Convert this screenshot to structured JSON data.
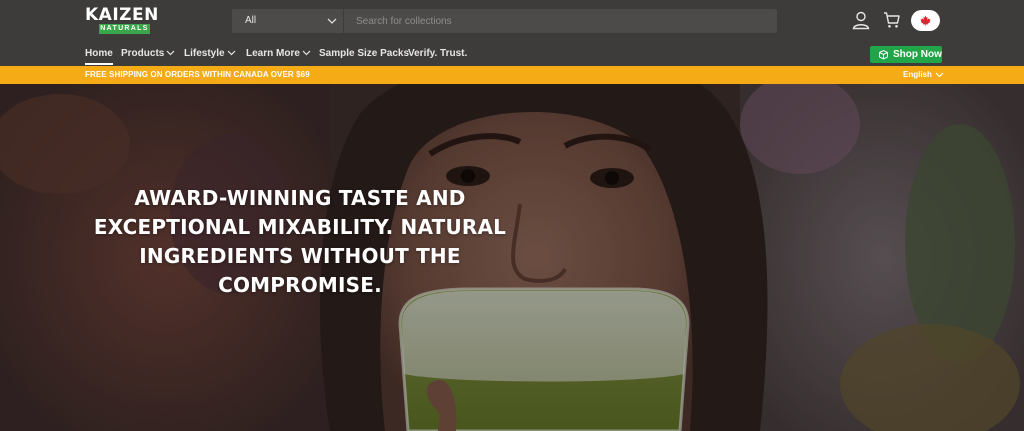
{
  "brand": {
    "logo_main": "KAIZEN",
    "logo_sub": "NATURALS"
  },
  "search": {
    "category": "All",
    "placeholder": "Search for collections"
  },
  "header_icons": {
    "account": "user-icon",
    "cart": "cart-icon",
    "region": "canada-flag-icon"
  },
  "nav": {
    "items": [
      {
        "label": "Home",
        "active": true,
        "dropdown": false
      },
      {
        "label": "Products",
        "active": false,
        "dropdown": true
      },
      {
        "label": "Lifestyle",
        "active": false,
        "dropdown": true
      },
      {
        "label": "Learn More",
        "active": false,
        "dropdown": true
      },
      {
        "label": "Sample Size Packs",
        "active": false,
        "dropdown": false
      },
      {
        "label": "Verify. Trust.",
        "active": false,
        "dropdown": false
      }
    ],
    "shop_now": "Shop Now"
  },
  "promo": {
    "text": "FREE SHIPPING ON ORDERS WITHIN CANADA OVER $69",
    "language": "English"
  },
  "hero": {
    "headline": "AWARD-WINNING TASTE AND EXCEPTIONAL MIXABILITY. NATURAL INGREDIENTS WITHOUT THE COMPROMISE."
  },
  "colors": {
    "header_bg": "#3d3c3a",
    "promo_bg": "#f5ab15",
    "shop_button": "#22a448",
    "logo_green": "#3aa54a"
  }
}
